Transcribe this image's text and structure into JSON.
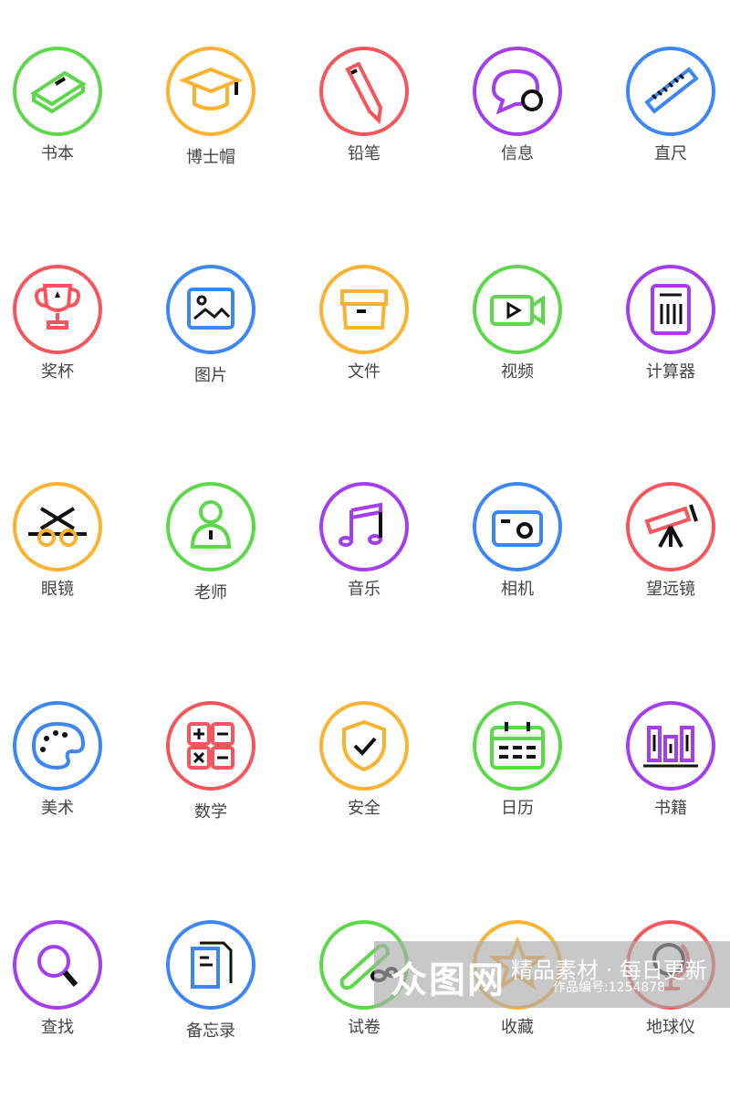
{
  "colors": {
    "green": "#5cd84a",
    "orange": "#fdb22f",
    "red": "#f5555b",
    "purple": "#a43cf0",
    "blue": "#3c87f5"
  },
  "icons": [
    {
      "label": "书本",
      "color": "green",
      "icon": "book-icon"
    },
    {
      "label": "博士帽",
      "color": "orange",
      "icon": "graduation-cap-icon"
    },
    {
      "label": "铅笔",
      "color": "red",
      "icon": "pencil-icon"
    },
    {
      "label": "信息",
      "color": "purple",
      "icon": "message-icon"
    },
    {
      "label": "直尺",
      "color": "blue",
      "icon": "ruler-icon"
    },
    {
      "label": "奖杯",
      "color": "red",
      "icon": "trophy-icon"
    },
    {
      "label": "图片",
      "color": "blue",
      "icon": "image-icon"
    },
    {
      "label": "文件",
      "color": "orange",
      "icon": "file-box-icon"
    },
    {
      "label": "视频",
      "color": "green",
      "icon": "video-icon"
    },
    {
      "label": "计算器",
      "color": "purple",
      "icon": "calculator-icon"
    },
    {
      "label": "眼镜",
      "color": "orange",
      "icon": "glasses-icon"
    },
    {
      "label": "老师",
      "color": "green",
      "icon": "teacher-icon"
    },
    {
      "label": "音乐",
      "color": "purple",
      "icon": "music-icon"
    },
    {
      "label": "相机",
      "color": "blue",
      "icon": "camera-icon"
    },
    {
      "label": "望远镜",
      "color": "red",
      "icon": "telescope-icon"
    },
    {
      "label": "美术",
      "color": "blue",
      "icon": "palette-icon"
    },
    {
      "label": "数学",
      "color": "red",
      "icon": "math-icon"
    },
    {
      "label": "安全",
      "color": "orange",
      "icon": "shield-icon"
    },
    {
      "label": "日历",
      "color": "green",
      "icon": "calendar-icon"
    },
    {
      "label": "书籍",
      "color": "purple",
      "icon": "books-icon"
    },
    {
      "label": "查找",
      "color": "purple",
      "icon": "search-icon"
    },
    {
      "label": "备忘录",
      "color": "blue",
      "icon": "memo-icon"
    },
    {
      "label": "试卷",
      "color": "green",
      "icon": "scroll-icon"
    },
    {
      "label": "收藏",
      "color": "orange",
      "icon": "star-icon"
    },
    {
      "label": "地球仪",
      "color": "red",
      "icon": "globe-icon"
    }
  ],
  "watermark": {
    "logo": "众图网",
    "slogan": "精品素材 · 每日更新",
    "code": "作品编号:1254878"
  }
}
